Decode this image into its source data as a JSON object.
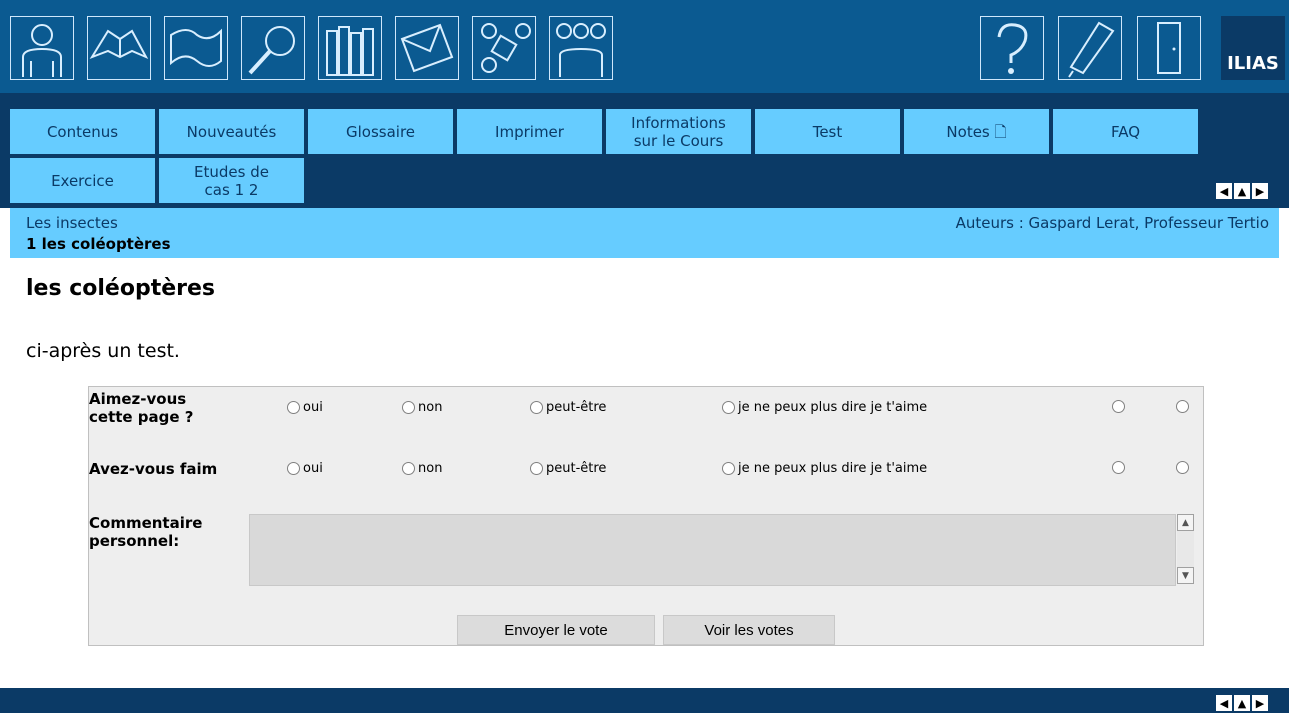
{
  "header": {
    "brand": "ILIAS"
  },
  "tabs_row1": [
    "Contenus",
    "Nouveautés",
    "Glossaire",
    "Imprimer",
    "Informations sur le Cours",
    "Test",
    "Notes 🗋",
    "FAQ"
  ],
  "tabs_row2": [
    "Exercice",
    "Etudes de cas 1 2"
  ],
  "breadcrumb": {
    "parent": "Les insectes",
    "current": "1 les coléoptères"
  },
  "authors": "Auteurs : Gaspard Lerat, Professeur Tertio",
  "page": {
    "title": "les coléoptères",
    "intro": "ci-après un test."
  },
  "poll": {
    "q1": "Aimez-vous cette page ?",
    "q2": "Avez-vous faim",
    "options": [
      "oui",
      "non",
      "peut-être",
      "je ne peux plus dire je t'aime"
    ],
    "comment_label": "Commentaire personnel:",
    "submit": "Envoyer le vote",
    "view": "Voir les votes"
  },
  "arrows": {
    "prev": "◀",
    "up": "▲",
    "next": "▶"
  }
}
